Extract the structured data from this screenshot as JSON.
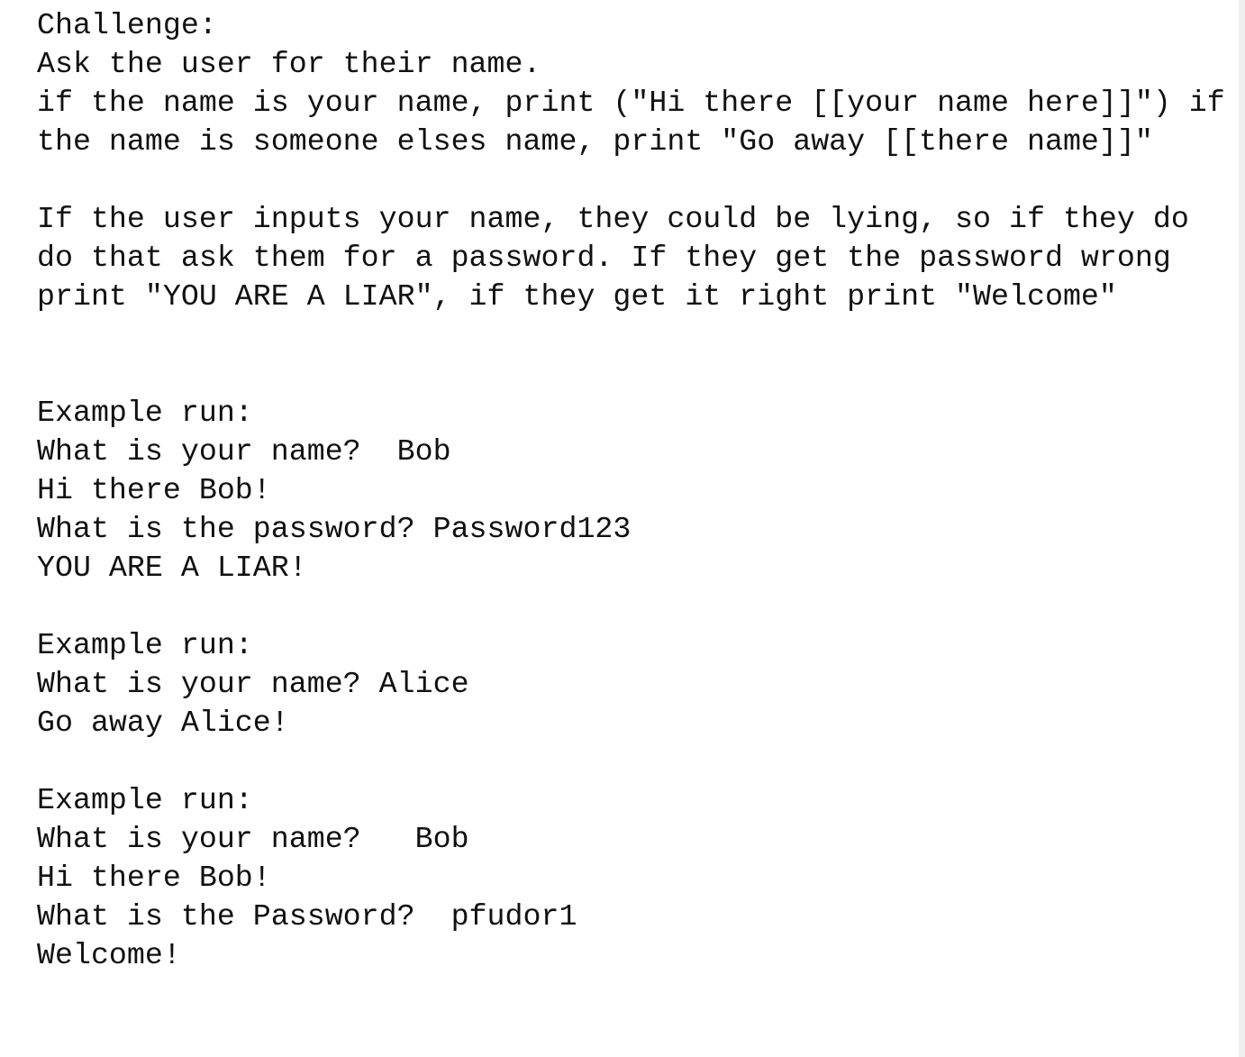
{
  "lines": [
    "Challenge:",
    "Ask the user for their name.",
    "if the name is your name, print (\"Hi there [[your name here]]\") if",
    "the name is someone elses name, print \"Go away [[there name]]\"",
    "",
    "If the user inputs your name, they could be lying, so if they do",
    "do that ask them for a password. If they get the password wrong",
    "print \"YOU ARE A LIAR\", if they get it right print \"Welcome\"",
    "",
    "",
    "Example run:",
    "What is your name?  Bob",
    "Hi there Bob!",
    "What is the password? Password123",
    "YOU ARE A LIAR!",
    "",
    "Example run:",
    "What is your name? Alice",
    "Go away Alice!",
    "",
    "Example run:",
    "What is your name?   Bob",
    "Hi there Bob!",
    "What is the Password?  pfudor1",
    "Welcome!"
  ]
}
